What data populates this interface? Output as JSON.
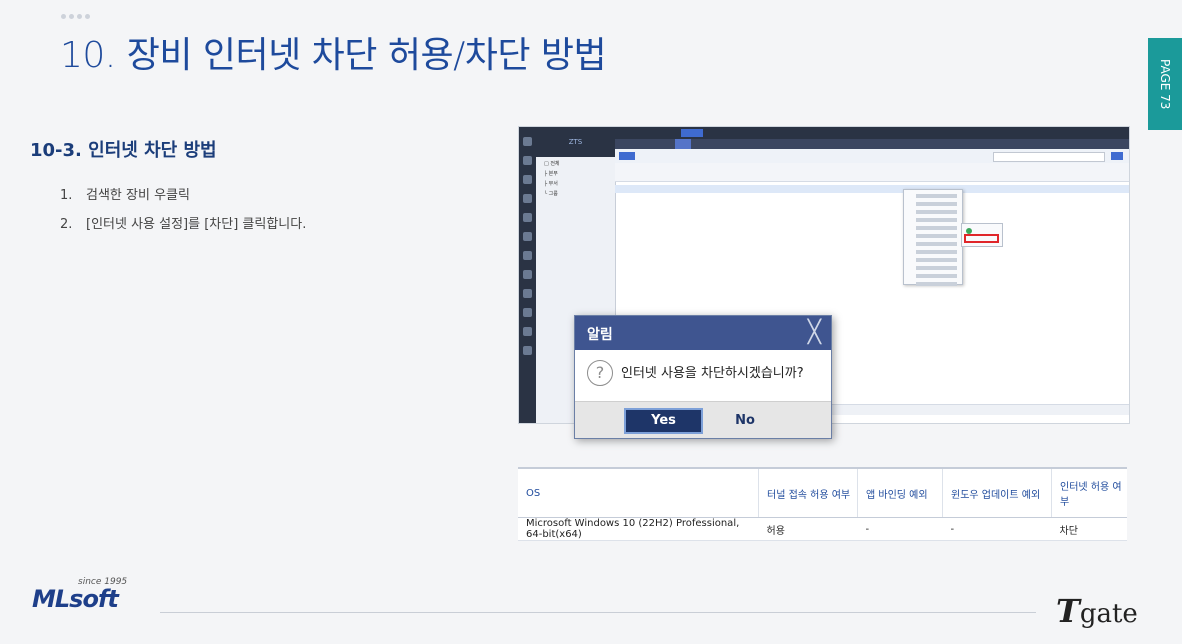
{
  "title": "10. 장비 인터넷 차단 허용/차단 방법",
  "page_label": "PAGE 73",
  "section": {
    "heading": "10-3. 인터넷 차단 방법",
    "steps": [
      {
        "num": "1.",
        "text": "검색한 장비 우클릭"
      },
      {
        "num": "2.",
        "text": "[인터넷 사용 설정]를 [차단] 클릭합니다."
      }
    ]
  },
  "dialog": {
    "title": "알림",
    "message": "인터넷 사용을 차단하시겠습니까?",
    "yes": "Yes",
    "no": "No",
    "close_glyph": "╳",
    "question_glyph": "?"
  },
  "table": {
    "headers": [
      "OS",
      "터널 접속 허용 여부",
      "앱 바인딩 예외",
      "윈도우 업데이트 예외",
      "인터넷 허용 여부"
    ],
    "row": [
      "Microsoft Windows 10 (22H2) Professional, 64-bit(x64)",
      "허용",
      "-",
      "-",
      "차단"
    ]
  },
  "footer": {
    "ml_since": "since 1995",
    "ml_logo": "MLsoft",
    "tgate_logo_t": "T",
    "tgate_logo_rest": "gate"
  },
  "colors": {
    "title_blue": "#1e4a9c",
    "teal_tab": "#1b9a9a",
    "dialog_header": "#3f5590",
    "highlight_red": "#e0262a"
  }
}
